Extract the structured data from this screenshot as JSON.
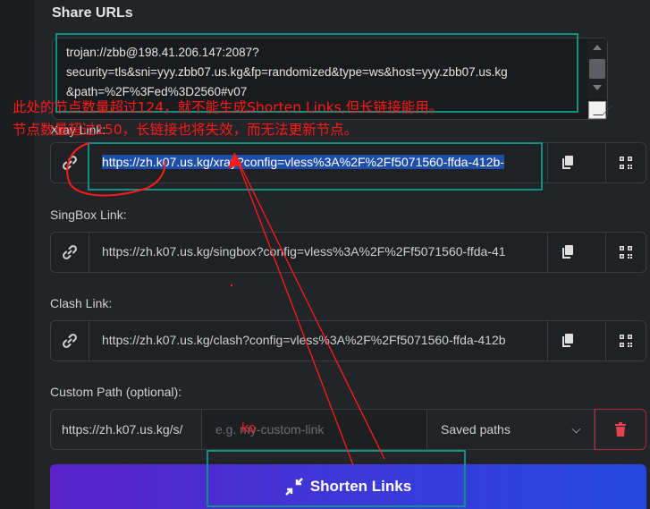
{
  "section": {
    "title": "Share URLs"
  },
  "share_textarea": {
    "value": "trojan://zbb@198.41.206.147:2087?\nsecurity=tls&sni=yyy.zbb07.us.kg&fp=randomized&type=ws&host=yyy.zbb07.us.kg\n&path=%2F%3Fed%3D2560#v07"
  },
  "xray": {
    "label": "Xray Link:",
    "value": "https://zh.k07.us.kg/xray?config=vless%3A%2F%2Ff5071560-ffda-412b-"
  },
  "singbox": {
    "label": "SingBox Link:",
    "value": "https://zh.k07.us.kg/singbox?config=vless%3A%2F%2Ff5071560-ffda-41"
  },
  "clash": {
    "label": "Clash Link:",
    "value": "https://zh.k07.us.kg/clash?config=vless%3A%2F%2Ff5071560-ffda-412b"
  },
  "custom_path": {
    "label": "Custom Path (optional):",
    "prefix": "https://zh.k07.us.kg/s/",
    "placeholder": "e.g. my-custom-link",
    "saved_paths": "Saved paths"
  },
  "shorten_button": {
    "label": "Shorten Links"
  },
  "annotations": {
    "line1": "此处的节点数量超过124，就不能生成Shorten Links,但长链接能用。",
    "line2": "节点数量超过150，长链接也将失效，而无法更新节点。",
    "ko_mark": "ko"
  },
  "icons": {
    "link": "link-icon",
    "copy": "copy-icon",
    "qr": "qrcode-icon",
    "trash": "trash-icon",
    "shrink": "compress-arrows-icon"
  },
  "colors": {
    "background": "#1b1c1e",
    "panel": "#232427",
    "accent_start": "#5a22c8",
    "accent_end": "#2247e0",
    "danger": "#d9363e",
    "annotation": "#ff1a1a",
    "highlight_box": "#0e8f86",
    "selection": "#1f4ea8"
  }
}
